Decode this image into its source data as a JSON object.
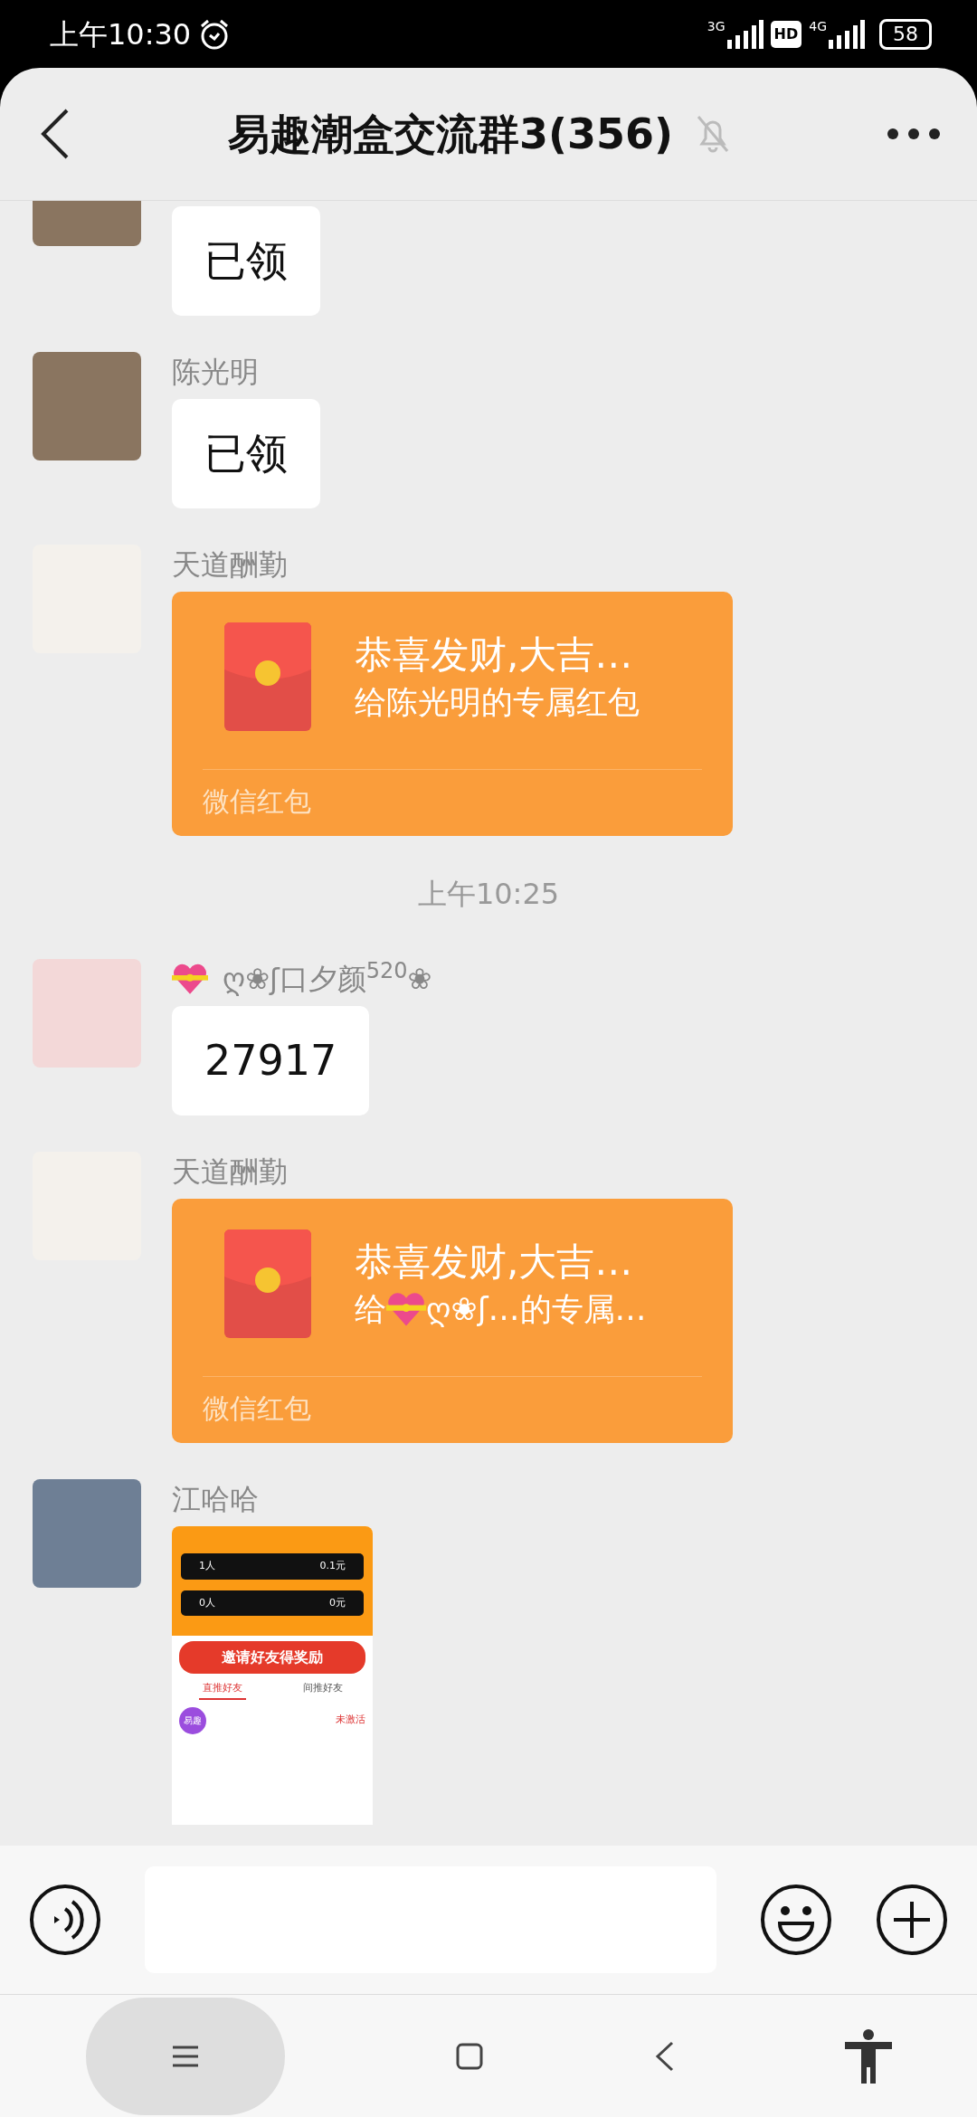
{
  "status_bar": {
    "time": "上午10:30",
    "network_1": "3G",
    "hd": "HD",
    "network_2": "4G",
    "battery": "58"
  },
  "header": {
    "title": "易趣潮盒交流群3(356)",
    "muted": true
  },
  "messages": [
    {
      "kind": "text",
      "text": "已领"
    },
    {
      "kind": "text",
      "sender": "陈光明",
      "text": "已领"
    },
    {
      "kind": "red_packet",
      "sender": "天道酬勤",
      "title": "恭喜发财,大吉…",
      "subtitle": [
        {
          "kind": "text",
          "text": "给陈光明的专属红包"
        }
      ],
      "footer": "微信红包"
    },
    {
      "kind": "time",
      "text": "上午10:25"
    },
    {
      "kind": "text",
      "sender": [
        {
          "kind": "gift_heart"
        },
        {
          "kind": "text",
          "text": "ღ❀ʃ口夕颜$^{520}$❀"
        }
      ],
      "text": "27917"
    },
    {
      "kind": "red_packet",
      "sender": "天道酬勤",
      "title": "恭喜发财,大吉…",
      "subtitle": [
        {
          "kind": "text",
          "text": "给"
        },
        {
          "kind": "gift_heart"
        },
        {
          "kind": "text",
          "text": " ღ❀ʃ…的专属…"
        }
      ],
      "footer": "微信红包"
    },
    {
      "kind": "image",
      "sender": "江哈哈",
      "screenshot": {
        "stats": [
          {
            "left": "1人",
            "right": "0.1元"
          },
          {
            "left": "0人",
            "right": "0元"
          }
        ],
        "banner": "邀请好友得奖励",
        "tabs": [
          {
            "label": "直推好友",
            "selected": true
          },
          {
            "label": "间推好友",
            "selected": false
          }
        ],
        "card_badge": "易趣",
        "card_status": "未激活"
      }
    }
  ]
}
